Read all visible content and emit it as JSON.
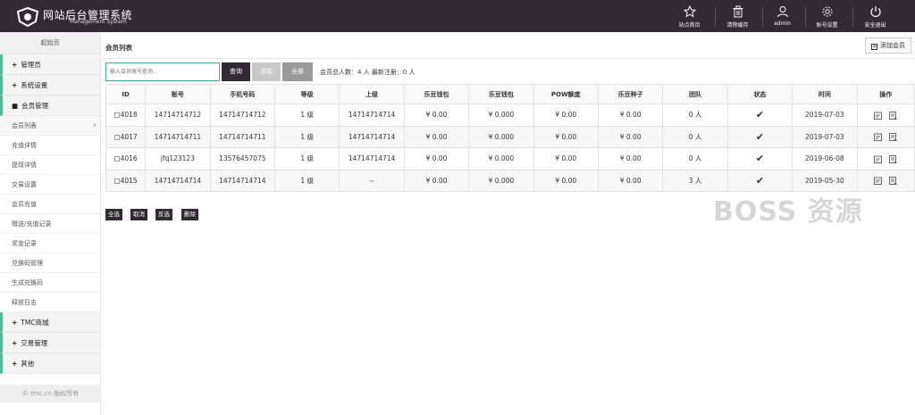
{
  "header": {
    "title": "网站后台管理系统",
    "subtitle": "Management System",
    "nav": [
      {
        "label": "站点首页",
        "icon": "star-icon"
      },
      {
        "label": "清除缓存",
        "icon": "trash-icon"
      },
      {
        "label": "admin",
        "icon": "user-icon"
      },
      {
        "label": "账号设置",
        "icon": "gear-icon"
      },
      {
        "label": "安全退出",
        "icon": "power-icon"
      }
    ]
  },
  "sidebar": {
    "home": "起始页",
    "groups": [
      {
        "label": "管理员",
        "prefix": "+"
      },
      {
        "label": "系统设置",
        "prefix": "+"
      },
      {
        "label": "会员管理",
        "prefix": "■",
        "items": [
          "会员列表",
          "充值详情",
          "提现详情",
          "交易设置",
          "会员充值",
          "赠送/充值记录",
          "奖金记录",
          "兑换码管理",
          "生成兑换码",
          "释放日志"
        ]
      },
      {
        "label": "TMC商城",
        "prefix": "+"
      },
      {
        "label": "交易管理",
        "prefix": "+"
      },
      {
        "label": "其他",
        "prefix": "+"
      }
    ],
    "footer": "© tmc.cn 版权所有"
  },
  "main": {
    "title": "会员列表",
    "add_button": "添加会员",
    "search": {
      "placeholder": "输入会员账号查询..."
    },
    "buttons": {
      "query": "查询",
      "frozen": "冻结",
      "all": "全部"
    },
    "stats": "会员总人数：4 人 最新注册：0 人",
    "columns": [
      "ID",
      "账号",
      "手机号码",
      "等级",
      "上级",
      "乐豆钱包",
      "乐豆钱包",
      "POW额度",
      "乐豆种子",
      "团队",
      "状态",
      "时间",
      "操作"
    ],
    "rows": [
      {
        "id": "4018",
        "account": "14714714712",
        "phone": "14714714712",
        "level": "1 级",
        "parent": "14714714714",
        "w1": "¥ 0.00",
        "w2": "¥ 0.000",
        "pow": "¥ 0.00",
        "seed": "¥ 0.00",
        "team": "0 人",
        "status": "✔",
        "time": "2019-07-03"
      },
      {
        "id": "4017",
        "account": "14714714711",
        "phone": "14714714711",
        "level": "1 级",
        "parent": "14714714714",
        "w1": "¥ 0.00",
        "w2": "¥ 0.000",
        "pow": "¥ 0.00",
        "seed": "¥ 0.00",
        "team": "0 人",
        "status": "✔",
        "time": "2019-07-03"
      },
      {
        "id": "4016",
        "account": "jfq123123",
        "phone": "13576457075",
        "level": "1 级",
        "parent": "14714714714",
        "w1": "¥ 0.00",
        "w2": "¥ 0.000",
        "pow": "¥ 0.00",
        "seed": "¥ 0.00",
        "team": "0 人",
        "status": "✔",
        "time": "2019-06-08"
      },
      {
        "id": "4015",
        "account": "14714714714",
        "phone": "14714714714",
        "level": "1 级",
        "parent": "--",
        "w1": "¥ 0.00",
        "w2": "¥ 0.000",
        "pow": "¥ 0.00",
        "seed": "¥ 0.00",
        "team": "3 人",
        "status": "✔",
        "time": "2019-05-30"
      }
    ],
    "bottom_buttons": [
      "全选",
      "取消",
      "反选",
      "删除"
    ]
  },
  "watermark": "BOSS 资源",
  "colors": {
    "topbar": "#2f2b31",
    "accent": "#53b89b"
  }
}
